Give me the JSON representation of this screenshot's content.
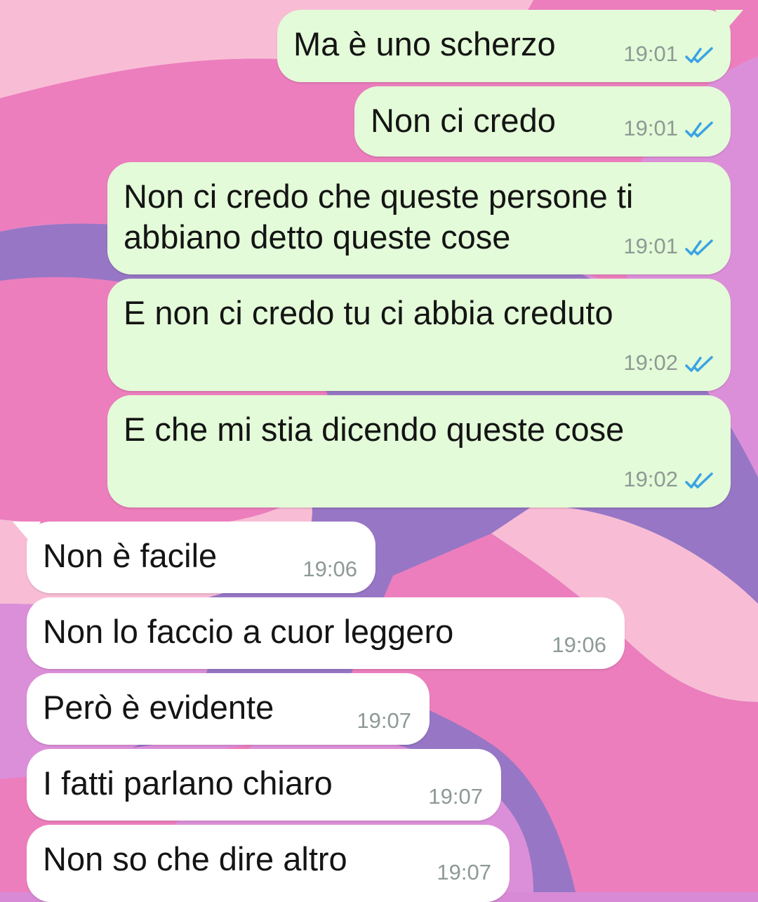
{
  "chat": {
    "colors": {
      "outgoing_bubble": "#e3fbd8",
      "incoming_bubble": "#ffffff",
      "read_ticks": "#3aa3e3",
      "timestamp": "#8e9a95"
    },
    "messages": [
      {
        "direction": "outgoing",
        "text": "Ma è uno scherzo",
        "time": "19:01",
        "status": "read"
      },
      {
        "direction": "outgoing",
        "text": "Non ci credo",
        "time": "19:01",
        "status": "read"
      },
      {
        "direction": "outgoing",
        "text": "Non ci credo che queste persone ti abbiano detto queste cose",
        "time": "19:01",
        "status": "read"
      },
      {
        "direction": "outgoing",
        "text": "E non ci credo tu ci abbia creduto",
        "time": "19:02",
        "status": "read"
      },
      {
        "direction": "outgoing",
        "text": "E che mi stia dicendo queste cose",
        "time": "19:02",
        "status": "read"
      },
      {
        "direction": "incoming",
        "text": "Non è facile",
        "time": "19:06"
      },
      {
        "direction": "incoming",
        "text": "Non lo faccio a cuor leggero",
        "time": "19:06"
      },
      {
        "direction": "incoming",
        "text": "Però è evidente",
        "time": "19:07"
      },
      {
        "direction": "incoming",
        "text": "I fatti parlano chiaro",
        "time": "19:07"
      },
      {
        "direction": "incoming",
        "text": "Non so che dire altro",
        "time": "19:07"
      }
    ]
  }
}
